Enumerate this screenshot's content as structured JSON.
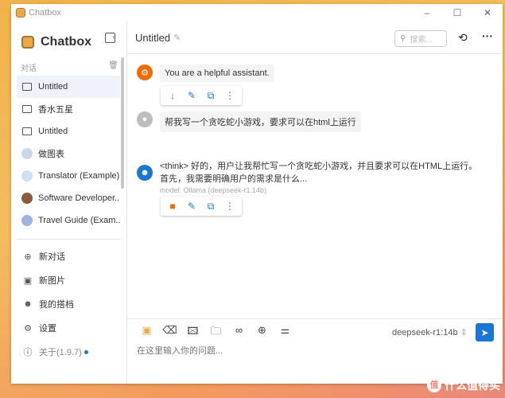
{
  "window": {
    "title": "Chatbox",
    "minimize": "–",
    "maximize": "☐",
    "close": "✕"
  },
  "sidebar": {
    "brand": "Chatbox",
    "section_label": "对话",
    "items": [
      {
        "label": "Untitled",
        "icon": "chat-icon"
      },
      {
        "label": "香水五星",
        "icon": "chat-icon"
      },
      {
        "label": "Untitled",
        "icon": "chat-icon"
      },
      {
        "label": "做图表",
        "icon": "avatar"
      },
      {
        "label": "Translator (Example)",
        "icon": "avatar"
      },
      {
        "label": "Software Developer...",
        "icon": "avatar"
      },
      {
        "label": "Travel Guide (Exam...",
        "icon": "avatar"
      }
    ],
    "nav": [
      {
        "label": "新对话",
        "icon": "⊕"
      },
      {
        "label": "新图片",
        "icon": "▣"
      },
      {
        "label": "我的搭档",
        "icon": "☻"
      },
      {
        "label": "设置",
        "icon": "⚙"
      },
      {
        "label": "关于(1.9.7)",
        "icon": "ⓘ"
      }
    ]
  },
  "header": {
    "title": "Untitled",
    "search_placeholder": "搜索..."
  },
  "messages": [
    {
      "role": "system",
      "text": "You are a helpful assistant."
    },
    {
      "role": "user",
      "text": "帮我写一个贪吃蛇小游戏，要求可以在html上运行"
    },
    {
      "role": "assistant",
      "text": "<think> 好的，用户让我帮忙写一个贪吃蛇小游戏，并且要求可以在HTML上运行。首先，我需要明确用户的需求是什么...",
      "meta": "model: Ollama (deepseek-r1:14b)"
    }
  ],
  "composer": {
    "model": "deepseek-r1:14b",
    "placeholder": "在这里输入你的问题..."
  },
  "watermark": "什么值得买",
  "colors": {
    "accent": "#1976d2",
    "system": "#ef6c00"
  }
}
